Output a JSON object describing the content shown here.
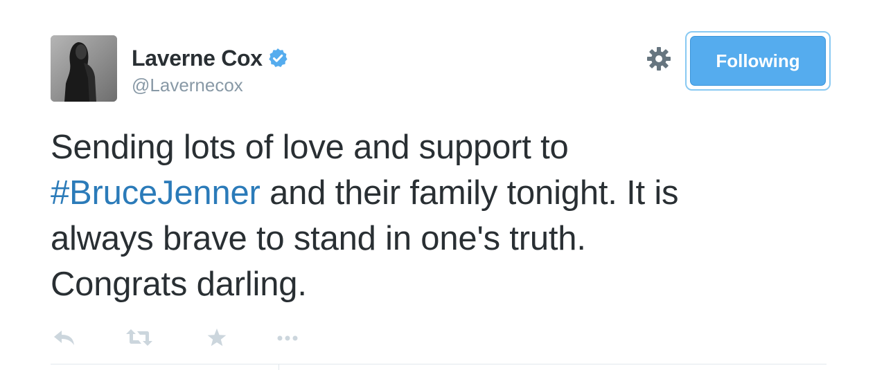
{
  "tweet": {
    "author": {
      "display_name": "Laverne Cox",
      "handle": "@Lavernecox",
      "verified": true
    },
    "follow_button_label": "Following",
    "text": {
      "line1": "Sending lots of love and support to",
      "hashtag": "#BruceJenner",
      "after_hashtag": " and their family tonight. It is",
      "line3": "always brave to stand in one's truth.",
      "line4": "Congrats darling."
    },
    "actions": [
      "reply-icon",
      "retweet-icon",
      "favorite-icon",
      "more-icon"
    ],
    "icons": {
      "settings": "gear-icon",
      "verified": "verified-badge-icon"
    },
    "colors": {
      "follow_button": "#55acee",
      "hashtag": "#2b7bb9",
      "verified": "#55acee",
      "muted": "#8899a6",
      "action_icon": "#ccd6dd"
    }
  }
}
